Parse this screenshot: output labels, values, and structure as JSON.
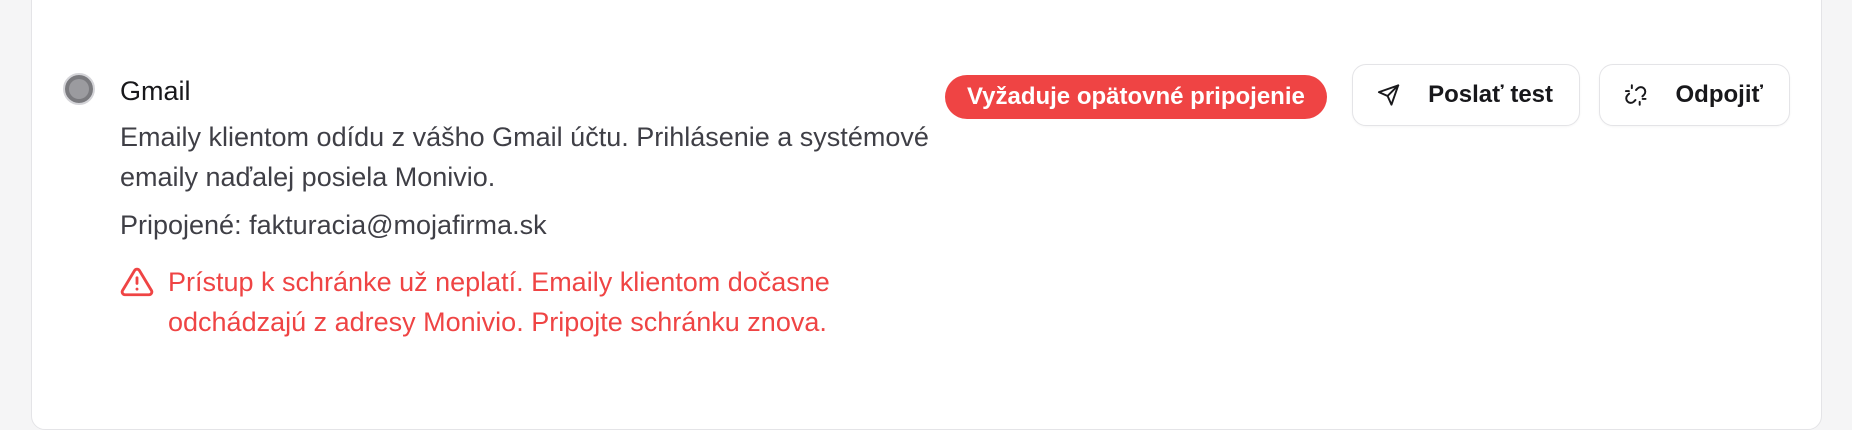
{
  "integration": {
    "name": "Gmail",
    "description": "Emaily klientom odídu z vášho Gmail účtu. Prihlásenie a systémové emaily naďalej posiela Monivio.",
    "connected": "Pripojené: fakturacia@mojafirma.sk",
    "warning": "Prístup k schránke už neplatí. Emaily klientom dočasne odchádzajú z adresy Monivio. Pripojte schránku znova.",
    "status_badge": "Vyžaduje opätovné pripojenie",
    "status_color": "#ef4444"
  },
  "actions": {
    "send_test_label": "Poslať test",
    "send_test_icon": "send-icon",
    "disconnect_label": "Odpojiť",
    "disconnect_icon": "unlink-icon"
  },
  "icons": {
    "status": "status-dot-icon",
    "warning": "warning-triangle-icon"
  }
}
